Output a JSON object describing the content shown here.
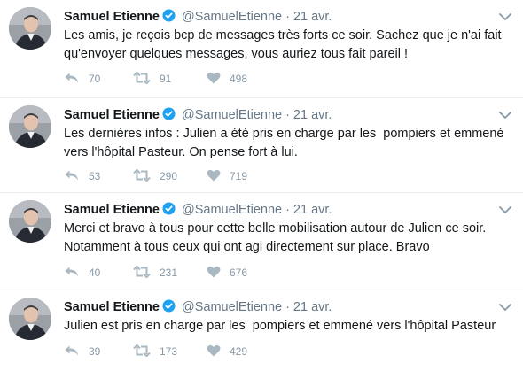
{
  "tweets": [
    {
      "author_name": "Samuel Etienne",
      "handle": "@SamuelEtienne",
      "separator": "·",
      "date": "21 avr.",
      "text": "Les amis, je reçois bcp de messages très forts ce soir. Sachez que je n'ai fait qu'envoyer quelques messages, vous auriez tous fait pareil !",
      "replies": "70",
      "retweets": "91",
      "likes": "498"
    },
    {
      "author_name": "Samuel Etienne",
      "handle": "@SamuelEtienne",
      "separator": "·",
      "date": "21 avr.",
      "text": "Les dernières infos : Julien a été pris en charge par les  pompiers et emmené vers l'hôpital Pasteur. On pense fort à lui.",
      "replies": "53",
      "retweets": "290",
      "likes": "719"
    },
    {
      "author_name": "Samuel Etienne",
      "handle": "@SamuelEtienne",
      "separator": "·",
      "date": "21 avr.",
      "text": "Merci et bravo à tous pour cette belle mobilisation autour de Julien ce soir. Notamment à tous ceux qui ont agi directement sur place. Bravo",
      "replies": "40",
      "retweets": "231",
      "likes": "676"
    },
    {
      "author_name": "Samuel Etienne",
      "handle": "@SamuelEtienne",
      "separator": "·",
      "date": "21 avr.",
      "text": "Julien est pris en charge par les  pompiers et emmené vers l'hôpital Pasteur",
      "replies": "39",
      "retweets": "173",
      "likes": "429"
    }
  ],
  "colors": {
    "verified": "#1da1f2",
    "muted": "#657786",
    "icon": "#8899a6",
    "divider": "#e6ecf0"
  },
  "icons": {
    "verified": "verified-badge-icon",
    "caret": "chevron-down-icon",
    "reply": "reply-icon",
    "retweet": "retweet-icon",
    "like": "heart-icon"
  }
}
